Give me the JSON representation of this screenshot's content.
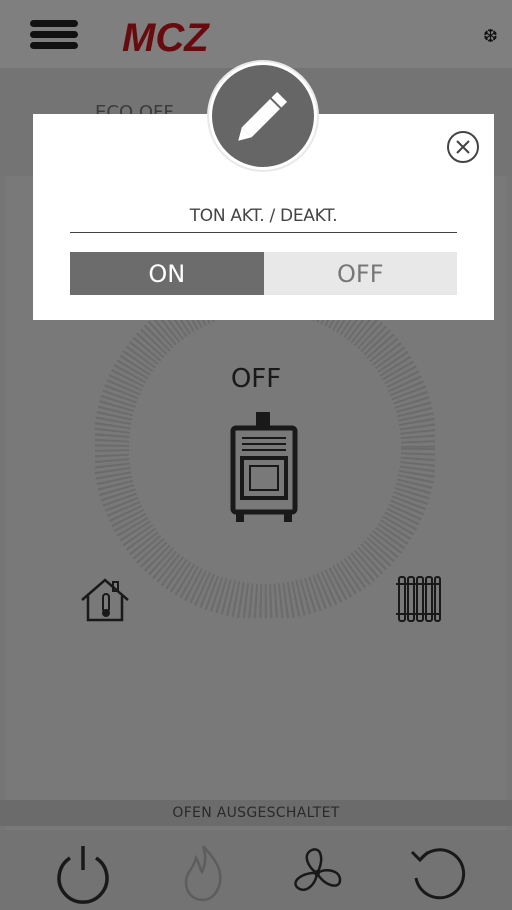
{
  "header": {
    "menu_icon": "hamburger-menu-icon",
    "logo_text": "MCZ",
    "brand_color": "#d0161d",
    "snow_icon": "❆"
  },
  "info": {
    "mode": "",
    "left": "ECO OFF",
    "right": ""
  },
  "dial": {
    "status": "OFF"
  },
  "status_bar": {
    "text": "OFEN AUSGESCHALTET"
  },
  "bottom_nav": {
    "items": [
      {
        "icon": "power-icon"
      },
      {
        "icon": "flame-icon"
      },
      {
        "icon": "fan-icon"
      },
      {
        "icon": "refresh-icon"
      }
    ]
  },
  "modal": {
    "icon": "pencil-icon",
    "close_icon": "close-circle-icon",
    "label": "TON AKT. / DEAKT.",
    "toggle": {
      "on_label": "ON",
      "off_label": "OFF",
      "selected": "ON"
    }
  }
}
